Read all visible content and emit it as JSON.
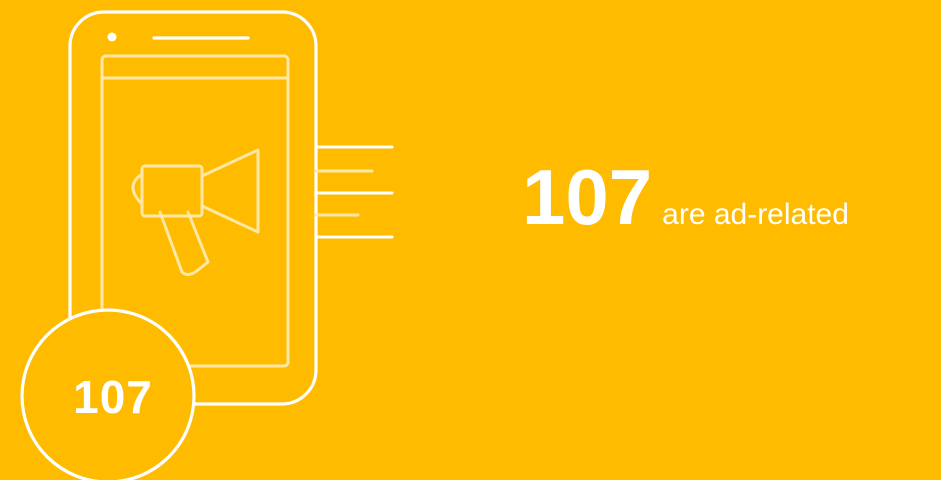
{
  "colors": {
    "background": "#FFBB00",
    "foreground": "#FFFFFF"
  },
  "illustration": {
    "icons": [
      "phone-icon",
      "megaphone-icon",
      "speed-lines-icon"
    ]
  },
  "badge": {
    "value": "107"
  },
  "stat": {
    "value": "107",
    "label": "are ad-related"
  }
}
